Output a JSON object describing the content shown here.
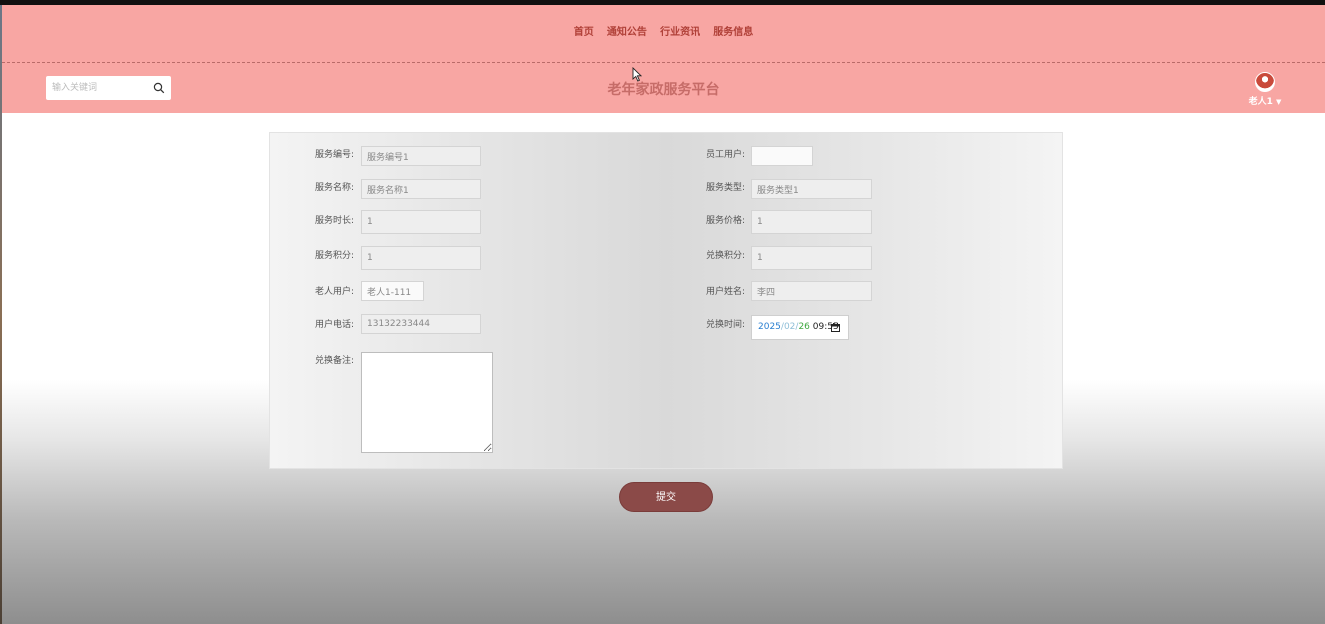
{
  "nav": {
    "items": [
      {
        "label": "首页"
      },
      {
        "label": "通知公告"
      },
      {
        "label": "行业资讯"
      },
      {
        "label": "服务信息"
      }
    ]
  },
  "search": {
    "placeholder": "输入关键词",
    "icon": "search-icon"
  },
  "site": {
    "title": "老年家政服务平台"
  },
  "user": {
    "name": "老人1",
    "caret": "▼"
  },
  "form": {
    "left": [
      {
        "label": "服务编号:",
        "value": "服务编号1"
      },
      {
        "label": "服务名称:",
        "value": "服务名称1"
      },
      {
        "label": "服务时长:",
        "value": "1"
      },
      {
        "label": "服务积分:",
        "value": "1"
      },
      {
        "label": "老人用户:",
        "value": "老人1-111"
      },
      {
        "label": "用户电话:",
        "value": "13132233444"
      },
      {
        "label": "兑换备注:",
        "value": ""
      }
    ],
    "right": [
      {
        "label": "员工用户:",
        "value": ""
      },
      {
        "label": "服务类型:",
        "value": "服务类型1"
      },
      {
        "label": "服务价格:",
        "value": "1"
      },
      {
        "label": "兑换积分:",
        "value": "1"
      },
      {
        "label": "用户姓名:",
        "value": "李四"
      },
      {
        "label": "兑换时间:",
        "value": ""
      }
    ],
    "datetime": {
      "year": "2025",
      "month": "02",
      "day": "26",
      "sep": "/",
      "time": "09:55"
    }
  },
  "submit": {
    "label": "提交"
  },
  "colors": {
    "header": "#f8a6a3",
    "nav_text": "#b04038",
    "title": "#c66c68",
    "submit": "#8b4a48"
  }
}
